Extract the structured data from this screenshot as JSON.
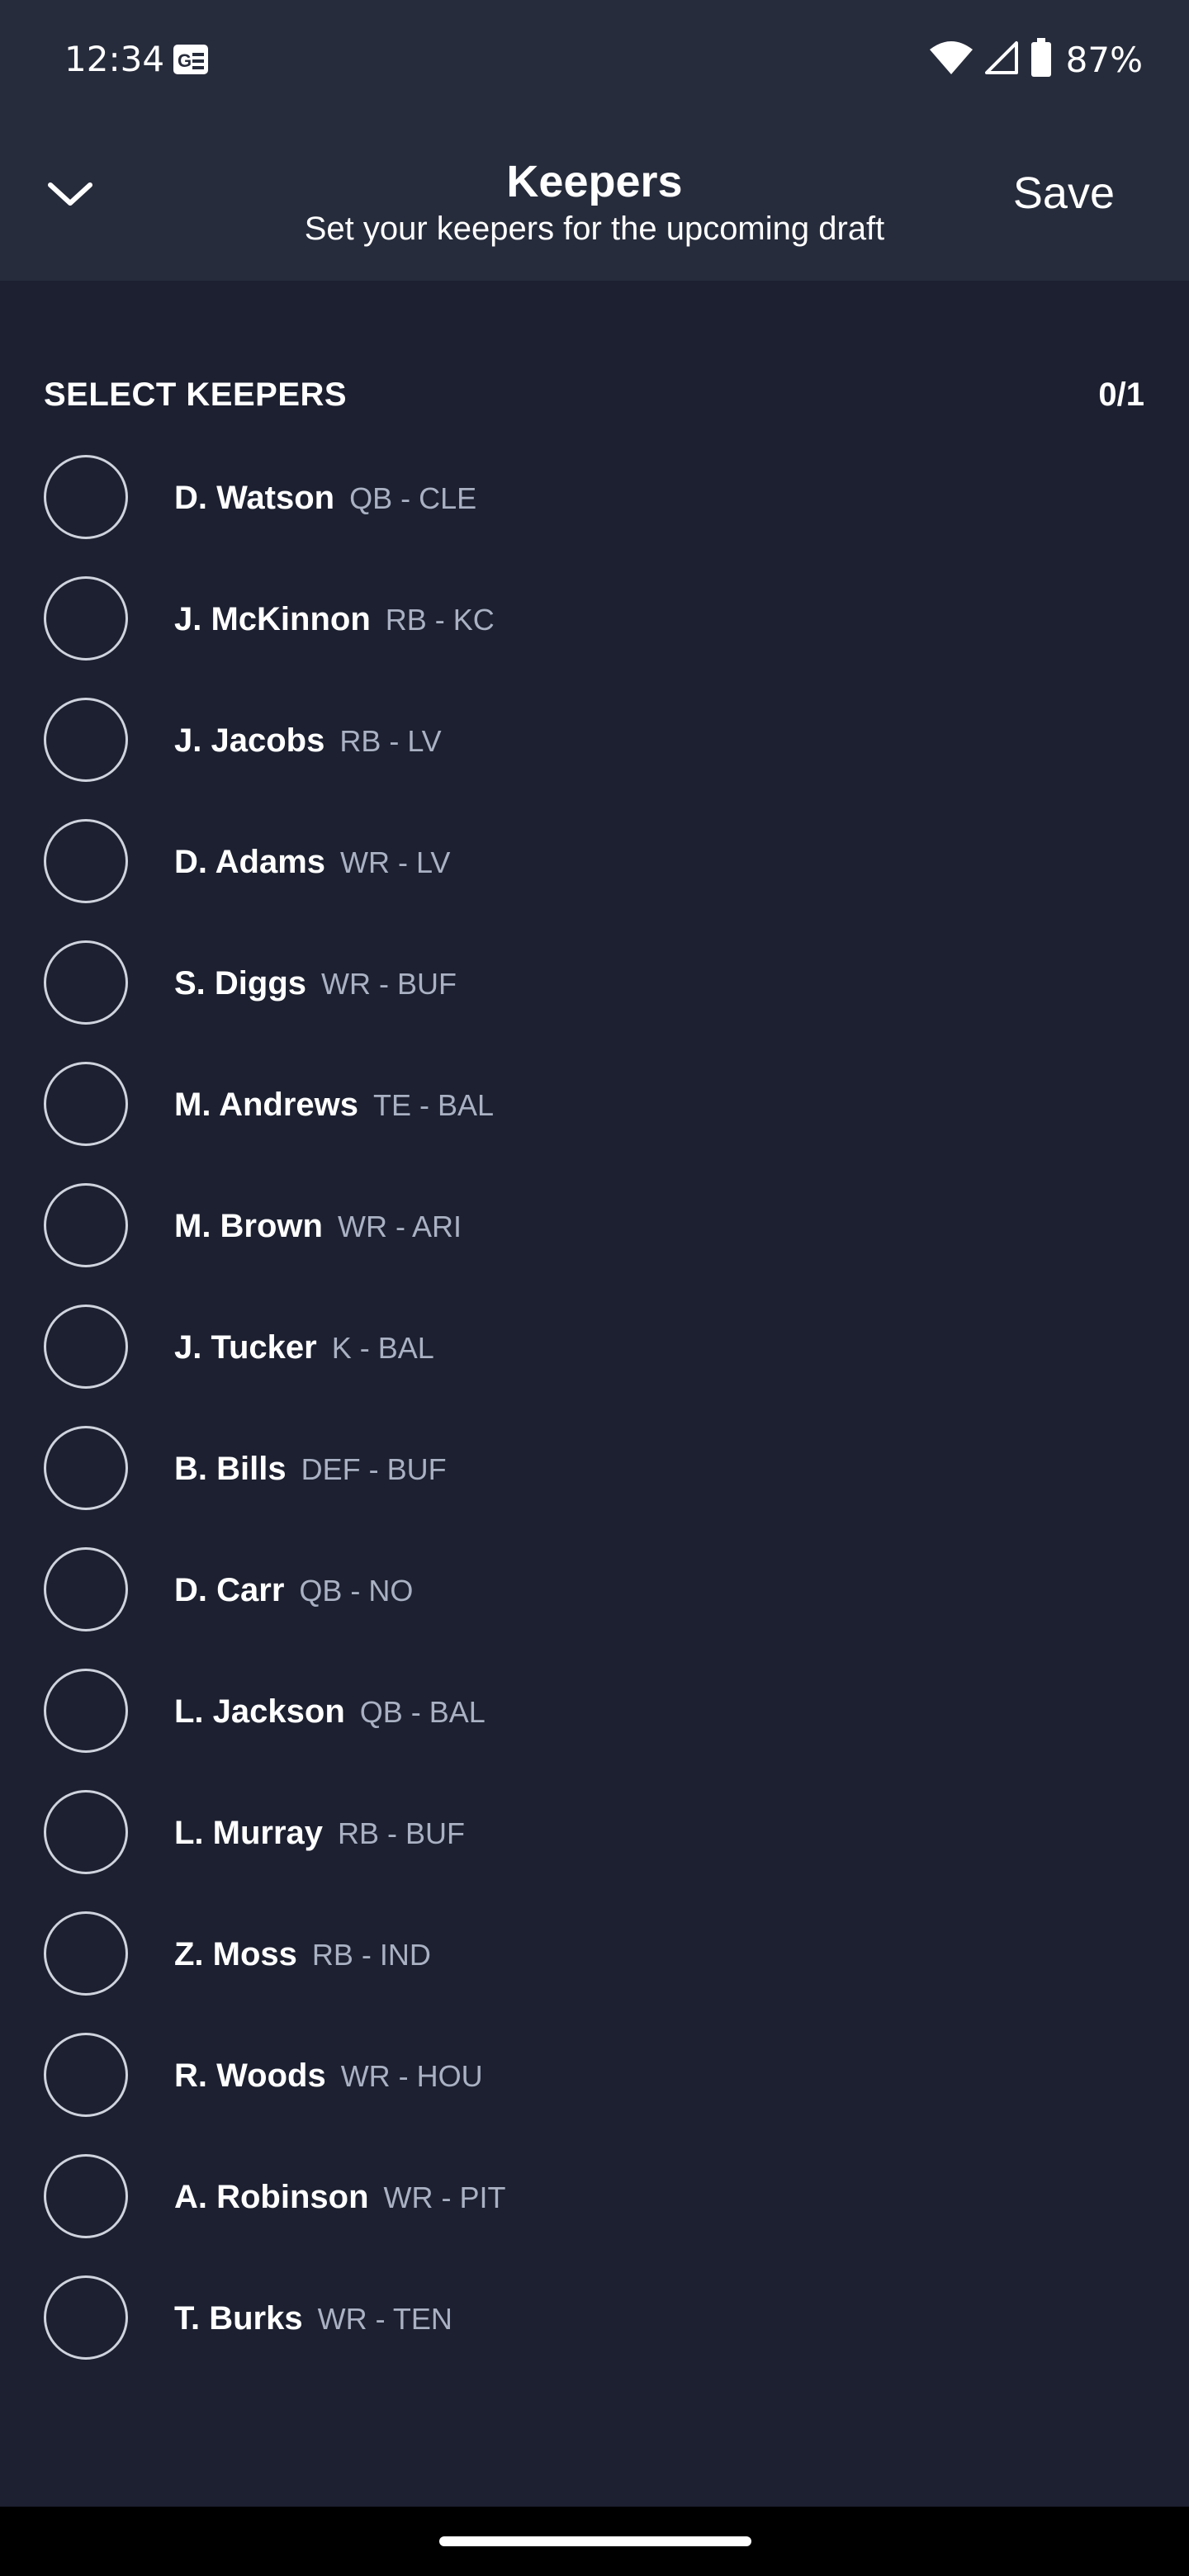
{
  "status_bar": {
    "time": "12:34",
    "battery": "87%",
    "icons": [
      "news-icon",
      "wifi-icon",
      "cellular-signal-icon",
      "battery-icon"
    ]
  },
  "header": {
    "title": "Keepers",
    "subtitle": "Set your keepers for the upcoming draft",
    "save_label": "Save",
    "collapse_icon": "chevron-down-icon"
  },
  "section": {
    "title": "SELECT KEEPERS",
    "count": "0/1"
  },
  "players": [
    {
      "name": "D. Watson",
      "meta": "QB - CLE"
    },
    {
      "name": "J. McKinnon",
      "meta": "RB - KC"
    },
    {
      "name": "J. Jacobs",
      "meta": "RB - LV"
    },
    {
      "name": "D. Adams",
      "meta": "WR - LV"
    },
    {
      "name": "S. Diggs",
      "meta": "WR - BUF"
    },
    {
      "name": "M. Andrews",
      "meta": "TE - BAL"
    },
    {
      "name": "M. Brown",
      "meta": "WR - ARI"
    },
    {
      "name": "J. Tucker",
      "meta": "K - BAL"
    },
    {
      "name": "B. Bills",
      "meta": "DEF - BUF"
    },
    {
      "name": "D. Carr",
      "meta": "QB - NO"
    },
    {
      "name": "L. Jackson",
      "meta": "QB - BAL"
    },
    {
      "name": "L. Murray",
      "meta": "RB - BUF"
    },
    {
      "name": "Z. Moss",
      "meta": "RB - IND"
    },
    {
      "name": "R. Woods",
      "meta": "WR - HOU"
    },
    {
      "name": "A. Robinson",
      "meta": "WR - PIT"
    },
    {
      "name": "T. Burks",
      "meta": "WR - TEN"
    }
  ],
  "colors": {
    "background": "#1c2030",
    "header_background": "#272c3c",
    "meta_text": "#a9b1c3",
    "circle_outline": "#cfd3dd"
  }
}
